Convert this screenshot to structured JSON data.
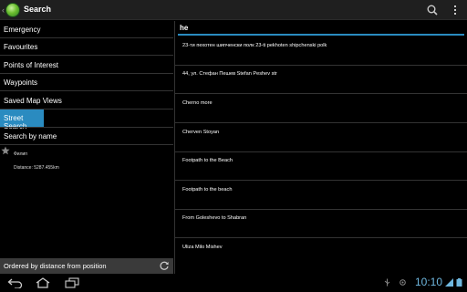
{
  "action_bar": {
    "title": "Search",
    "icons": [
      "app-globe-icon",
      "search-icon",
      "overflow-menu-icon"
    ]
  },
  "menu": {
    "items": [
      {
        "label": "Emergency"
      },
      {
        "label": "Favourites"
      },
      {
        "label": "Points of Interest"
      },
      {
        "label": "Waypoints"
      },
      {
        "label": "Saved Map Views"
      },
      {
        "label": "Street Search",
        "selected": true
      },
      {
        "label": "Search by name"
      }
    ]
  },
  "favourite": {
    "name": "Филип",
    "distance": "Distance: 5287.455km",
    "icon": "star-icon"
  },
  "order_bar": {
    "label": "Ordered by distance from position",
    "icon": "refresh-icon"
  },
  "search": {
    "value": "he",
    "accent_color": "#2a8bc0"
  },
  "results": [
    "23-ти пехотен шипченски полк 23-ti pekhoten shipchenski polk",
    "44, ул. Стефан Пешев Stefan Peshev str",
    "Cherno more",
    "Cherven Stoyan",
    "Footpath to the Beach",
    "Footpath to the beach",
    "From Goleshevo to Shabran",
    "Uliza Milo Mishev"
  ],
  "system_bar": {
    "clock": "10:10",
    "icons": [
      "back-icon",
      "home-icon",
      "recent-apps-icon",
      "usb-icon",
      "gps-icon",
      "signal-icon",
      "battery-icon"
    ]
  }
}
